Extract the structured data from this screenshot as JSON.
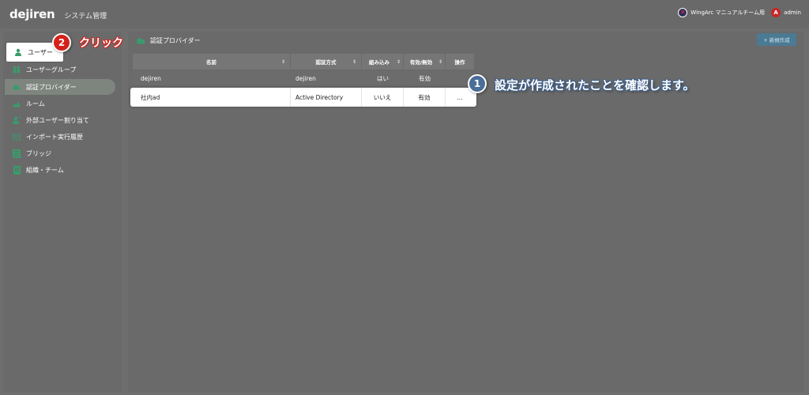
{
  "header": {
    "logo": "dejiren",
    "title": "システム管理",
    "team": "WingArc マニュアルチーム用",
    "avatar_letter": "A",
    "user": "admin"
  },
  "sidebar": {
    "items": [
      {
        "label": "ユーザー",
        "icon": "person-icon"
      },
      {
        "label": "ユーザーグループ",
        "icon": "group-icon"
      },
      {
        "label": "認証プロバイダー",
        "icon": "cloud-icon"
      },
      {
        "label": "ルーム",
        "icon": "room-icon"
      },
      {
        "label": "外部ユーザー割り当て",
        "icon": "external-user-icon"
      },
      {
        "label": "インポート実行履歴",
        "icon": "import-history-icon"
      },
      {
        "label": "ブリッジ",
        "icon": "bridge-icon"
      },
      {
        "label": "組織・チーム",
        "icon": "building-icon"
      }
    ]
  },
  "main": {
    "title": "認証プロバイダー",
    "new_button": "+ 新規作成",
    "table": {
      "headers": [
        "名前",
        "認証方式",
        "組み込み",
        "有効/無効",
        "操作"
      ],
      "rows": [
        [
          "dejiren",
          "dejiren",
          "はい",
          "有効",
          ""
        ],
        [
          "社内ad",
          "Active Directory",
          "いいえ",
          "有効",
          "..."
        ]
      ]
    }
  },
  "annotations": {
    "step1_number": "1",
    "step1_text": "設定が作成されたことを確認します。",
    "step2_number": "2",
    "step2_text": "クリック"
  },
  "colors": {
    "accent_green": "#3a9b6c",
    "annotation_blue": "#4b6e99",
    "annotation_red": "#d4211b"
  }
}
